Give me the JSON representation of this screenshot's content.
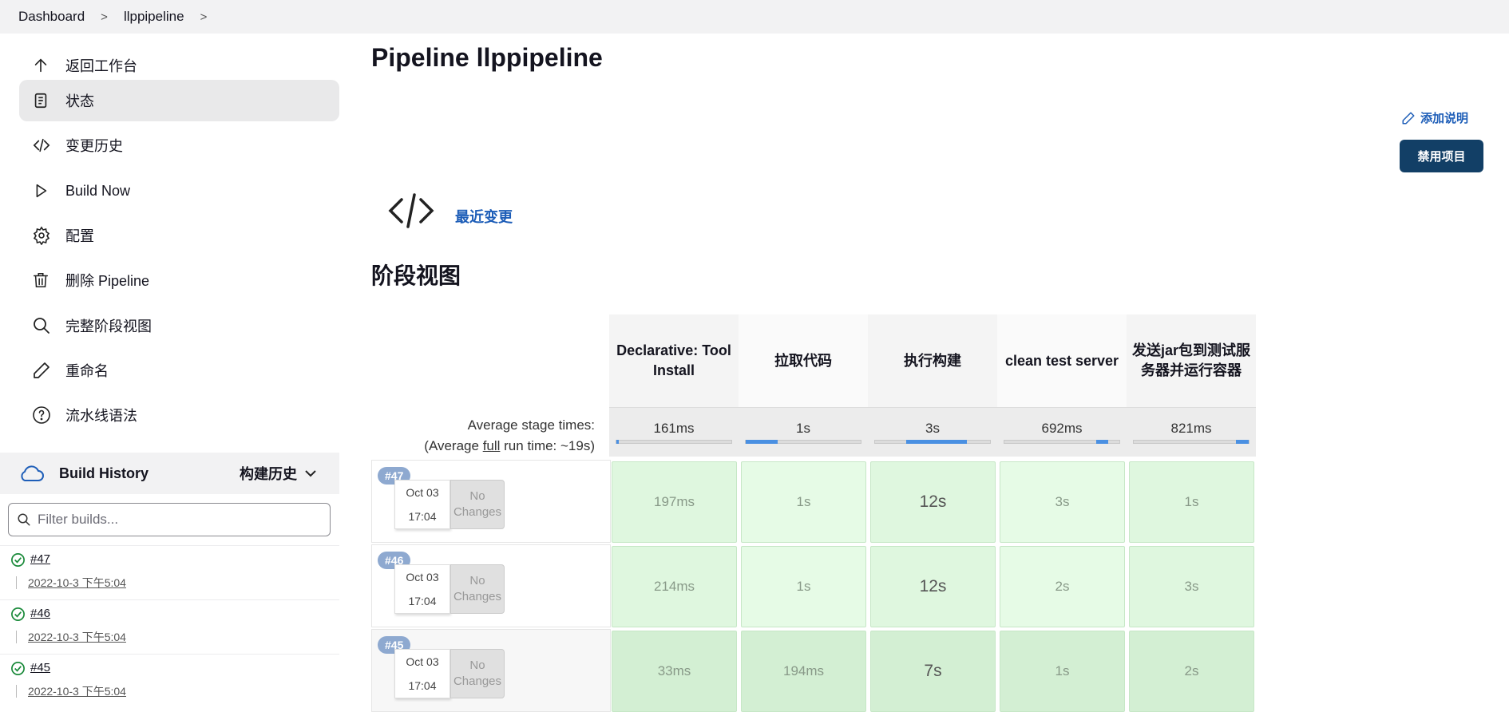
{
  "breadcrumb": {
    "items": [
      "Dashboard",
      "llppipeline"
    ]
  },
  "sidebar": {
    "tasks": [
      {
        "label": "返回工作台",
        "icon": "arrow-up-icon"
      },
      {
        "label": "状态",
        "icon": "document-icon"
      },
      {
        "label": "变更历史",
        "icon": "code-icon"
      },
      {
        "label": "Build Now",
        "icon": "play-icon"
      },
      {
        "label": "配置",
        "icon": "gear-icon"
      },
      {
        "label": "删除 Pipeline",
        "icon": "trash-icon"
      },
      {
        "label": "完整阶段视图",
        "icon": "search-icon"
      },
      {
        "label": "重命名",
        "icon": "pencil-icon"
      },
      {
        "label": "流水线语法",
        "icon": "help-icon"
      }
    ],
    "build_history": {
      "title": "Build History",
      "trend_label": "构建历史",
      "filter_placeholder": "Filter builds...",
      "builds": [
        {
          "number": "#47",
          "date": "2022-10-3 下午5:04"
        },
        {
          "number": "#46",
          "date": "2022-10-3 下午5:04"
        },
        {
          "number": "#45",
          "date": "2022-10-3 下午5:04"
        }
      ]
    }
  },
  "main": {
    "title": "Pipeline llppipeline",
    "add_description": "添加说明",
    "disable_button": "禁用项目",
    "recent_changes": "最近变更",
    "stage_view_title": "阶段视图"
  },
  "stage_view": {
    "avg_label_line1": "Average stage times:",
    "avg_label_line2_pre": "(Average ",
    "avg_label_line2_link": "full",
    "avg_label_line2_post": " run time: ~19s)",
    "stages": [
      {
        "name": "Declarative: Tool Install",
        "avg": "161ms",
        "bar_start": 0.0,
        "bar_fraction": 0.02
      },
      {
        "name": "拉取代码",
        "avg": "1s",
        "bar_start": 0.0,
        "bar_fraction": 0.28
      },
      {
        "name": "执行构建",
        "avg": "3s",
        "bar_start": 0.27,
        "bar_fraction": 0.53
      },
      {
        "name": "clean test server",
        "avg": "692ms",
        "bar_start": 0.8,
        "bar_fraction": 0.1
      },
      {
        "name": "发送jar包到测试服务器并运行容器",
        "avg": "821ms",
        "bar_start": 0.89,
        "bar_fraction": 0.11
      }
    ],
    "runs": [
      {
        "badge": "#47",
        "date": "Oct 03",
        "time": "17:04",
        "changes": "No Changes",
        "times": [
          "197ms",
          "1s",
          "12s",
          "3s",
          "1s"
        ]
      },
      {
        "badge": "#46",
        "date": "Oct 03",
        "time": "17:04",
        "changes": "No Changes",
        "times": [
          "214ms",
          "1s",
          "12s",
          "2s",
          "3s"
        ]
      },
      {
        "badge": "#45",
        "date": "Oct 03",
        "time": "17:04",
        "changes": "No Changes",
        "times": [
          "33ms",
          "194ms",
          "7s",
          "1s",
          "2s"
        ]
      }
    ]
  }
}
